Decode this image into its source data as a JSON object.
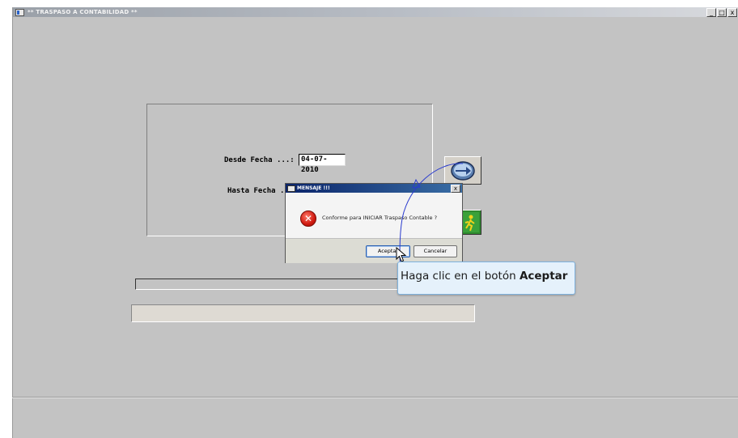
{
  "window": {
    "title": "** TRASPASO  A CONTABILIDAD **",
    "controls": [
      "_",
      "□",
      "x"
    ]
  },
  "form": {
    "desde_label": "Desde  Fecha ...:",
    "hasta_label": "Hasta  Fecha ...:",
    "desde_value": "04-07-2010"
  },
  "buttons": {
    "process_icon": "arrow-right-icon",
    "exit_icon": "running-man-icon"
  },
  "dialog": {
    "title": "MENSAJE !!!",
    "close": "x",
    "message": "Conforme para INICIAR Traspaso Contable ?",
    "icon": "error-icon",
    "accept": "Aceptar",
    "cancel": "Cancelar"
  },
  "tooltip": {
    "prefix": "Haga clic en el botón ",
    "emphasis": "Aceptar"
  },
  "colors": {
    "background": "#c3c3c3",
    "dialog_title": "#0a246a",
    "tooltip_bg": "#e5f1fb",
    "curve": "#2b3ccf"
  }
}
